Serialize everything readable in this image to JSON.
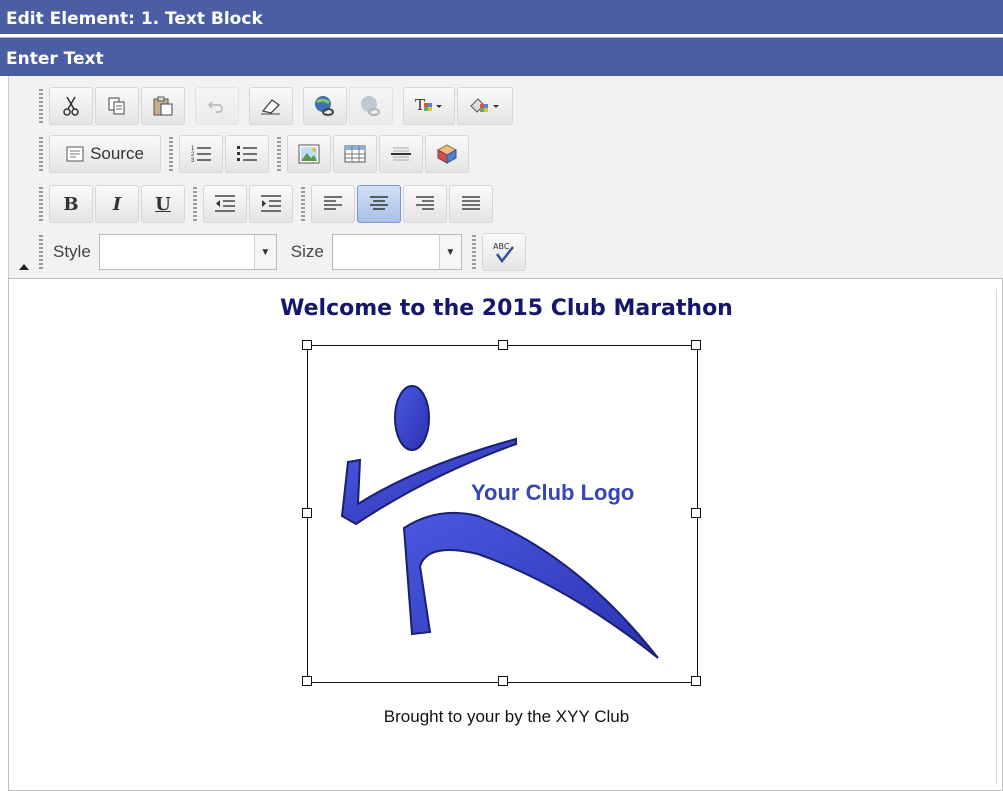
{
  "window": {
    "title": "Edit Element: 1. Text Block",
    "section": "Enter Text"
  },
  "toolbar": {
    "row1": [
      "cut-icon",
      "copy-icon",
      "paste-icon",
      "undo-icon",
      "eraser-icon",
      "link-icon",
      "unlink-icon",
      "text-color-icon",
      "background-color-icon"
    ],
    "source_label": "Source",
    "style_label": "Style",
    "style_value": "",
    "size_label": "Size",
    "size_value": "",
    "bold_label": "B",
    "italic_label": "I",
    "underline_label": "U",
    "spellcheck_label": "ABC"
  },
  "editor": {
    "heading": "Welcome to the 2015 Club Marathon",
    "logo_text": "Your Club Logo",
    "caption": "Brought to your by the XYY Club",
    "colors": {
      "heading": "#16166b",
      "logo": "#3645b8",
      "bars": "#4b5ea3"
    }
  }
}
